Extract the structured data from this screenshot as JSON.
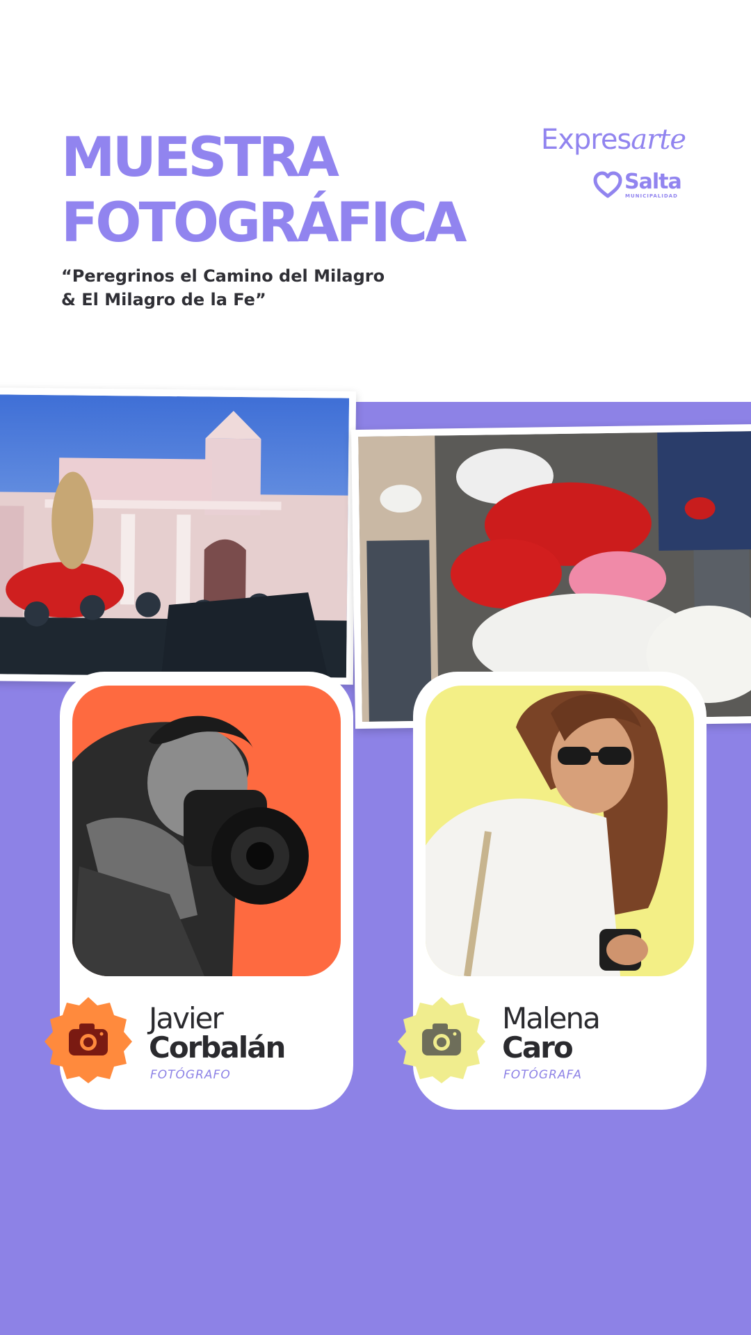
{
  "header": {
    "title_line1": "MUESTRA",
    "title_line2": "FOTOGRÁFICA",
    "subtitle_line1": "“Peregrinos el Camino del Milagro",
    "subtitle_line2": "& El Milagro de la Fe”"
  },
  "brand": {
    "expresarte_plain": "Expres",
    "expresarte_script": "arte",
    "salta_word": "Salta",
    "salta_sub": "MUNICIPALIDAD"
  },
  "photographers": [
    {
      "first_name": "Javier",
      "last_name": "Corbalán",
      "role": "FOTÓGRAFO",
      "icon": "camera-icon"
    },
    {
      "first_name": "Malena",
      "last_name": "Caro",
      "role": "FOTÓGRAFA",
      "icon": "camera-icon"
    }
  ],
  "colors": {
    "accent_purple": "#9184ef",
    "background_purple": "#8d82e6",
    "card_orange": "#ff6b3d",
    "card_yellow": "#f3ef86",
    "badge_orange": "#ff8a3d",
    "badge_yellow": "#f0ed8e"
  }
}
